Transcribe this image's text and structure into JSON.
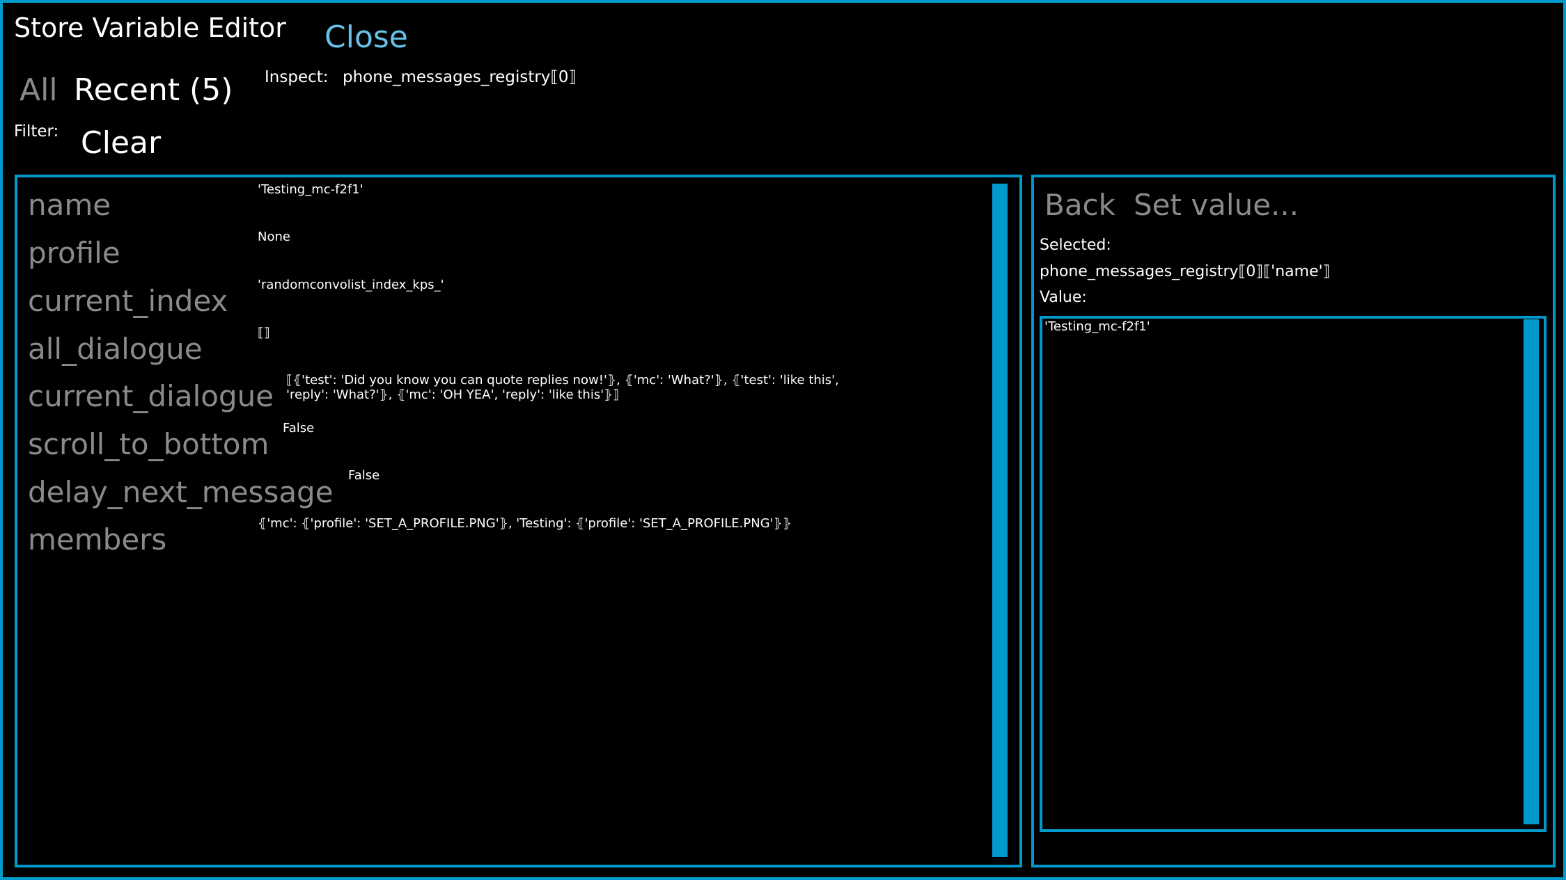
{
  "header": {
    "title": "Store Variable Editor",
    "close_label": "Close"
  },
  "tabs": {
    "all_label": "All",
    "recent_label": "Recent (5)"
  },
  "inspect": {
    "label": "Inspect:",
    "value": "phone_messages_registry⟦0⟧"
  },
  "filter": {
    "label": "Filter:",
    "clear_label": "Clear"
  },
  "variables": [
    {
      "name": "name",
      "value": "'Testing_mc-f2f1'"
    },
    {
      "name": "profile",
      "value": "None"
    },
    {
      "name": "current_index",
      "value": "'randomconvolist_index_kps_'"
    },
    {
      "name": "all_dialogue",
      "value": "⟦⟧"
    },
    {
      "name": "current_dialogue",
      "value": "⟦⦃'test': 'Did you know you can quote replies now!'⦄, ⦃'mc': 'What?'⦄, ⦃'test': 'like this', 'reply': 'What?'⦄, ⦃'mc': 'OH YEA', 'reply': 'like this'⦄⟧"
    },
    {
      "name": "scroll_to_bottom",
      "value": "False"
    },
    {
      "name": "delay_next_message",
      "value": "False"
    },
    {
      "name": "members",
      "value": "⦃'mc': ⦃'profile': 'SET_A_PROFILE.PNG'⦄, 'Testing': ⦃'profile': 'SET_A_PROFILE.PNG'⦄⦄"
    }
  ],
  "editor": {
    "back_label": "Back",
    "set_value_label": "Set value...",
    "selected_label": "Selected:",
    "selected_value": "phone_messages_registry⟦0⟧⟦'name'⟧",
    "value_label": "Value:",
    "value_text": "'Testing_mc-f2f1'"
  },
  "colors": {
    "accent": "#0099cc",
    "close_link": "#66c2e6",
    "muted_text": "#8a8a8a",
    "background": "#000000"
  }
}
